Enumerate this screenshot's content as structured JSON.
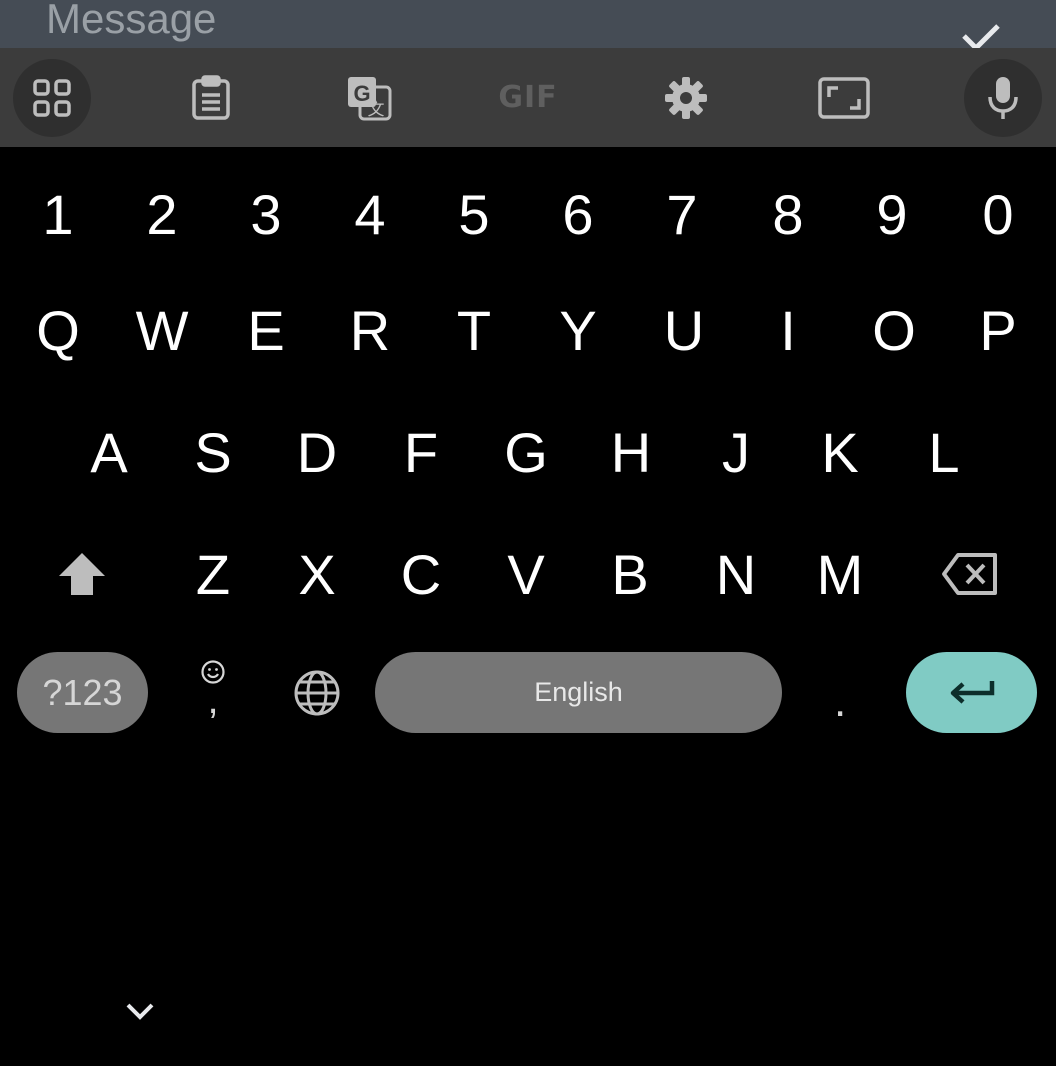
{
  "message_field": {
    "placeholder": "Message"
  },
  "toolbar": {
    "items": [
      {
        "name": "apps",
        "icon": "grid-icon"
      },
      {
        "name": "clipboard",
        "icon": "clipboard-icon"
      },
      {
        "name": "translate",
        "icon": "translate-icon"
      },
      {
        "name": "gif",
        "label": "GIF"
      },
      {
        "name": "settings",
        "icon": "gear-icon"
      },
      {
        "name": "resize",
        "icon": "resize-icon"
      },
      {
        "name": "voice",
        "icon": "microphone-icon"
      }
    ]
  },
  "keyboard": {
    "number_row": [
      "1",
      "2",
      "3",
      "4",
      "5",
      "6",
      "7",
      "8",
      "9",
      "0"
    ],
    "row1": [
      "Q",
      "W",
      "E",
      "R",
      "T",
      "Y",
      "U",
      "I",
      "O",
      "P"
    ],
    "row2": [
      "A",
      "S",
      "D",
      "F",
      "G",
      "H",
      "J",
      "K",
      "L"
    ],
    "row3": [
      "Z",
      "X",
      "C",
      "V",
      "B",
      "N",
      "M"
    ],
    "bottom": {
      "symbols_label": "?123",
      "comma_label": ",",
      "space_label": "English",
      "period_label": "."
    }
  },
  "colors": {
    "keyboard_bg": "#000000",
    "toolbar_bg": "#3c3c3c",
    "key_pill": "#767676",
    "enter_accent": "#80cbc4"
  }
}
